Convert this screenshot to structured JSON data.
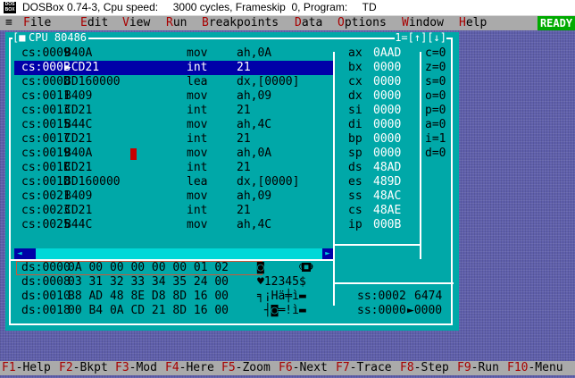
{
  "window": {
    "title": "DOSBox 0.74-3, Cpu speed:     3000 cycles, Frameskip  0, Program:     TD",
    "icon_text": "DOS BOX"
  },
  "menu": {
    "system_glyph": "≡",
    "items": [
      {
        "hot": "F",
        "rest": "ile"
      },
      {
        "hot": "E",
        "rest": "dit"
      },
      {
        "hot": "V",
        "rest": "iew"
      },
      {
        "hot": "R",
        "rest": "un"
      },
      {
        "hot": "B",
        "rest": "reakpoints"
      },
      {
        "hot": "D",
        "rest": "ata"
      },
      {
        "hot": "O",
        "rest": "ptions"
      },
      {
        "hot": "W",
        "rest": "indow"
      },
      {
        "hot": "H",
        "rest": "elp"
      }
    ],
    "status": "READY"
  },
  "cpu_window": {
    "close_box": "[■]",
    "title": "CPU 80486",
    "right_controls": "1=[↑][↓]"
  },
  "disassembly": [
    {
      "addr": "cs:0009",
      "bytes": "B40A",
      "op": "mov",
      "args": "ah,0A"
    },
    {
      "addr": "cs:000B",
      "bytes": "►CD21",
      "op": "int",
      "args": "21",
      "selected": true
    },
    {
      "addr": "cs:000D",
      "bytes": "8D160000",
      "op": "lea",
      "args": "dx,[0000]"
    },
    {
      "addr": "cs:0011",
      "bytes": "B409",
      "op": "mov",
      "args": "ah,09"
    },
    {
      "addr": "cs:0013",
      "bytes": "CD21",
      "op": "int",
      "args": "21"
    },
    {
      "addr": "cs:0015",
      "bytes": "B44C",
      "op": "mov",
      "args": "ah,4C"
    },
    {
      "addr": "cs:0017",
      "bytes": "CD21",
      "op": "int",
      "args": "21"
    },
    {
      "addr": "cs:0019",
      "bytes": "B40A",
      "op": "mov",
      "args": "ah,0A"
    },
    {
      "addr": "cs:001B",
      "bytes": "CD21",
      "op": "int",
      "args": "21"
    },
    {
      "addr": "cs:001D",
      "bytes": "8D160000",
      "op": "lea",
      "args": "dx,[0000]"
    },
    {
      "addr": "cs:0021",
      "bytes": "B409",
      "op": "mov",
      "args": "ah,09"
    },
    {
      "addr": "cs:0023",
      "bytes": "CD21",
      "op": "int",
      "args": "21"
    },
    {
      "addr": "cs:0025",
      "bytes": "B44C",
      "op": "mov",
      "args": "ah,4C"
    }
  ],
  "registers": [
    {
      "name": "ax",
      "value": "0AAD"
    },
    {
      "name": "bx",
      "value": "0000"
    },
    {
      "name": "cx",
      "value": "0000"
    },
    {
      "name": "dx",
      "value": "0000"
    },
    {
      "name": "si",
      "value": "0000"
    },
    {
      "name": "di",
      "value": "0000"
    },
    {
      "name": "bp",
      "value": "0000"
    },
    {
      "name": "sp",
      "value": "0000"
    },
    {
      "name": "ds",
      "value": "48AD"
    },
    {
      "name": "es",
      "value": "489D"
    },
    {
      "name": "ss",
      "value": "48AC"
    },
    {
      "name": "cs",
      "value": "48AE"
    },
    {
      "name": "ip",
      "value": "000B"
    }
  ],
  "flags": [
    "c=0",
    "z=0",
    "s=0",
    "o=0",
    "p=0",
    "a=0",
    "i=1",
    "d=0"
  ],
  "dump": [
    {
      "addr": "ds:0000",
      "bytes": "0A 00 00 00 00 00 01 02",
      "ascii": "◙     ☺☻"
    },
    {
      "addr": "ds:0008",
      "bytes": "03 31 32 33 34 35 24 00",
      "ascii": "♥12345$ "
    },
    {
      "addr": "ds:0010",
      "bytes": "B8 AD 48 8E D8 8D 16 00",
      "ascii": "╕¡Hä╪ì▬ "
    },
    {
      "addr": "ds:0018",
      "bytes": "00 B4 0A CD 21 8D 16 00",
      "ascii": " ┤◙═!ì▬ "
    }
  ],
  "stack": [
    {
      "addr": "ss:0002",
      "value": "6474"
    },
    {
      "addr": "ss:0000",
      "value": "►0000"
    }
  ],
  "fkeys": [
    {
      "key": "F1",
      "label": "-Help"
    },
    {
      "key": "F2",
      "label": "-Bkpt"
    },
    {
      "key": "F3",
      "label": "-Mod"
    },
    {
      "key": "F4",
      "label": "-Here"
    },
    {
      "key": "F5",
      "label": "-Zoom"
    },
    {
      "key": "F6",
      "label": "-Next"
    },
    {
      "key": "F7",
      "label": "-Trace"
    },
    {
      "key": "F8",
      "label": "-Step"
    },
    {
      "key": "F9",
      "label": "-Run"
    },
    {
      "key": "F10",
      "label": "-Menu"
    }
  ],
  "colors": {
    "desktop": "#5f5fab",
    "window_bg": "#00a8a8",
    "selection": "#0000a8",
    "menubar": "#aaaaaa",
    "hotkey": "#a80000",
    "ready": "#00aa00"
  }
}
